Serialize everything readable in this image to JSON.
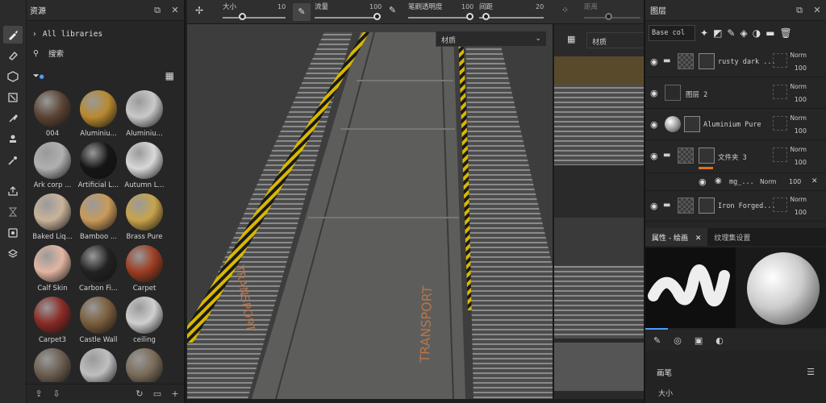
{
  "assets_panel": {
    "title": "资源",
    "libraries_label": "All libraries",
    "search_placeholder": "搜索",
    "items": [
      {
        "label": "004",
        "color": "#5b4334"
      },
      {
        "label": "Aluminiu...",
        "color": "#b8892e"
      },
      {
        "label": "Aluminiu...",
        "color": "#c9c9c9"
      },
      {
        "label": "Ark corp ...",
        "color": "#b0b0b0"
      },
      {
        "label": "Artificial L...",
        "color": "#151515"
      },
      {
        "label": "Autumn L...",
        "color": "#d8d8d8"
      },
      {
        "label": "Baked Liq...",
        "color": "#c9b39a"
      },
      {
        "label": "Bamboo ...",
        "color": "#c99a5a"
      },
      {
        "label": "Brass Pure",
        "color": "#c8a44a"
      },
      {
        "label": "Calf Skin",
        "color": "#e2b6a1"
      },
      {
        "label": "Carbon Fi...",
        "color": "#222222"
      },
      {
        "label": "Carpet",
        "color": "#9c3d22"
      },
      {
        "label": "Carpet3",
        "color": "#8a2a25"
      },
      {
        "label": "Castle Wall",
        "color": "#7a5d3c"
      },
      {
        "label": "ceiling",
        "color": "#cfcfcf"
      },
      {
        "label": "",
        "color": "#6a5d4f"
      },
      {
        "label": "",
        "color": "#bfbfbf"
      },
      {
        "label": "",
        "color": "#7a6a58"
      }
    ]
  },
  "topbar": {
    "size_label": "大小",
    "size_value": "10",
    "flow_label": "流量",
    "flow_value": "100",
    "opacity_label": "笔刷透明度",
    "opacity_value": "100",
    "spacing_label": "间距",
    "spacing_value": "20",
    "distance_label": "距离"
  },
  "viewport": {
    "material_dropdown": "材质",
    "uv_material_dropdown": "材质"
  },
  "layers_panel": {
    "title": "图层",
    "channel_select": "Base col",
    "layers": [
      {
        "name": "rusty dark ...",
        "blend": "Norm",
        "opacity": "100"
      },
      {
        "name": "图层 2",
        "blend": "Norm",
        "opacity": "100"
      },
      {
        "name": "Aluminium Pure",
        "blend": "Norm",
        "opacity": "100"
      },
      {
        "name": "文件夹 3",
        "blend": "Norm",
        "opacity": "100"
      },
      {
        "name": "Iron Forged...",
        "blend": "Norm",
        "opacity": "100"
      }
    ],
    "sub_layer": {
      "name": "mg_...",
      "blend": "Norm",
      "opacity": "100"
    }
  },
  "properties_panel": {
    "tab_active": "属性 - 绘画",
    "tab_other": "纹理集设置",
    "section_brush": "画笔",
    "size_label": "大小"
  }
}
